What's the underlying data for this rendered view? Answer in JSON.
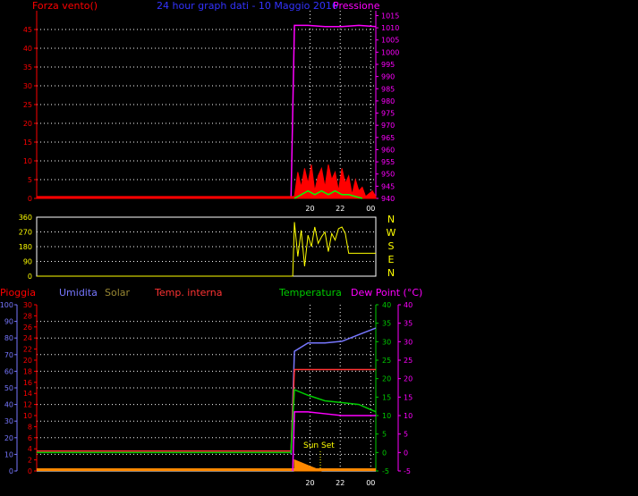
{
  "colors": {
    "wind": "#ff0000",
    "gust": "#00ff00",
    "pressure": "#ff00ff",
    "title": "#3333ff",
    "direction": "#ffff00",
    "humidity": "#7777ff",
    "solar": "#998833",
    "temp_internal": "#ff3333",
    "temperature": "#00cc00",
    "dewpoint": "#ff00ff",
    "rain": "#ff0000",
    "sunset": "#ffff00",
    "rain_fill": "#ff8800",
    "axis": "#ffffff"
  },
  "chart_data": [
    {
      "type": "area",
      "title": "24 hour graph dati - 10 Maggio 2016",
      "ylabel": "Forza vento()",
      "ylabel_right": "Pressione",
      "ylim": [
        0,
        50
      ],
      "ylim_right": [
        940,
        1017
      ],
      "yticks": [
        0,
        5,
        10,
        15,
        20,
        25,
        30,
        35,
        40,
        45
      ],
      "yticks_right": [
        940,
        945,
        950,
        955,
        960,
        965,
        970,
        975,
        980,
        985,
        990,
        995,
        1000,
        1005,
        1010,
        1015
      ],
      "x_ticks": [
        "20",
        "22",
        "00"
      ],
      "grid": true,
      "series": [
        {
          "name": "pressure",
          "x": [
            0.75,
            0.76,
            0.8,
            0.85,
            0.9,
            0.95,
            1.0
          ],
          "y": [
            940,
            1011,
            1011,
            1010.5,
            1010.5,
            1011,
            1010.5
          ]
        },
        {
          "name": "wind",
          "x": [
            0.0,
            0.76,
            0.77,
            0.78,
            0.79,
            0.8,
            0.81,
            0.82,
            0.83,
            0.84,
            0.85,
            0.86,
            0.87,
            0.88,
            0.89,
            0.9,
            0.91,
            0.92,
            0.93,
            0.94,
            0.95,
            0.96,
            0.97,
            0.99,
            1.0
          ],
          "y": [
            0.5,
            0.5,
            7,
            3,
            8,
            4,
            9,
            2,
            6,
            8,
            3,
            9,
            5,
            7,
            2,
            8,
            4,
            6,
            1,
            5,
            2,
            3,
            0.5,
            2,
            0.5
          ]
        },
        {
          "name": "gust",
          "x": [
            0.76,
            0.78,
            0.8,
            0.82,
            0.84,
            0.86,
            0.88,
            0.9,
            0.92,
            0.94,
            0.96
          ],
          "y": [
            0,
            1,
            2,
            1,
            2,
            1,
            2,
            1,
            1,
            0.5,
            0
          ]
        }
      ]
    },
    {
      "type": "line",
      "ylim": [
        0,
        360
      ],
      "yticks": [
        0,
        90,
        180,
        270,
        360
      ],
      "compass": [
        "N",
        "W",
        "S",
        "E",
        "N"
      ],
      "x_ticks": [],
      "series": [
        {
          "name": "direction",
          "x": [
            0.0,
            0.755,
            0.76,
            0.77,
            0.78,
            0.79,
            0.8,
            0.81,
            0.82,
            0.83,
            0.84,
            0.85,
            0.86,
            0.87,
            0.88,
            0.89,
            0.9,
            0.91,
            0.92,
            0.93,
            0.94,
            1.0
          ],
          "y": [
            0,
            0,
            330,
            120,
            280,
            60,
            250,
            180,
            300,
            200,
            240,
            270,
            150,
            260,
            220,
            290,
            300,
            260,
            140,
            140,
            140,
            140
          ]
        }
      ]
    },
    {
      "type": "line",
      "legend": [
        "Pioggia",
        "Umidita",
        "Solar",
        "Temp. interna",
        "Temperatura",
        "Dew Point (°C)"
      ],
      "ylim_left_humidity": [
        0,
        100
      ],
      "yticks_left_humidity": [
        0,
        10,
        20,
        30,
        40,
        50,
        60,
        70,
        80,
        90,
        100
      ],
      "ylim_left_rain": [
        0,
        30
      ],
      "yticks_left_rain": [
        0,
        2,
        4,
        6,
        8,
        10,
        12,
        14,
        16,
        18,
        20,
        22,
        24,
        26,
        28,
        30
      ],
      "ylim_right_temp": [
        -5,
        40
      ],
      "yticks_right_temp": [
        -5,
        0,
        5,
        10,
        15,
        20,
        25,
        30,
        35,
        40
      ],
      "x_ticks": [
        "20",
        "22",
        "00"
      ],
      "annotation": "Sun Set",
      "grid": true,
      "series": [
        {
          "name": "humidity",
          "x": [
            0.75,
            0.76,
            0.8,
            0.85,
            0.9,
            0.95,
            1.0
          ],
          "y": [
            10,
            72,
            77,
            77,
            78,
            82,
            86
          ]
        },
        {
          "name": "temp_internal",
          "x": [
            0.0,
            0.75,
            0.76,
            1.0
          ],
          "y": [
            12,
            12,
            61,
            61
          ]
        },
        {
          "name": "temperature",
          "x": [
            0.0,
            0.75,
            0.76,
            0.8,
            0.85,
            0.9,
            0.95,
            1.0
          ],
          "y": [
            0,
            0,
            17,
            15.5,
            14,
            13.5,
            13,
            11
          ]
        },
        {
          "name": "dewpoint",
          "x": [
            0.755,
            0.76,
            0.8,
            0.85,
            0.9,
            0.95,
            1.0
          ],
          "y": [
            -5,
            11,
            11,
            10.5,
            10,
            10,
            10
          ]
        },
        {
          "name": "solar",
          "x": [
            0.76,
            0.78,
            0.8,
            0.82,
            0.84
          ],
          "y": [
            2,
            1.5,
            1,
            0.5,
            0
          ]
        }
      ]
    }
  ]
}
